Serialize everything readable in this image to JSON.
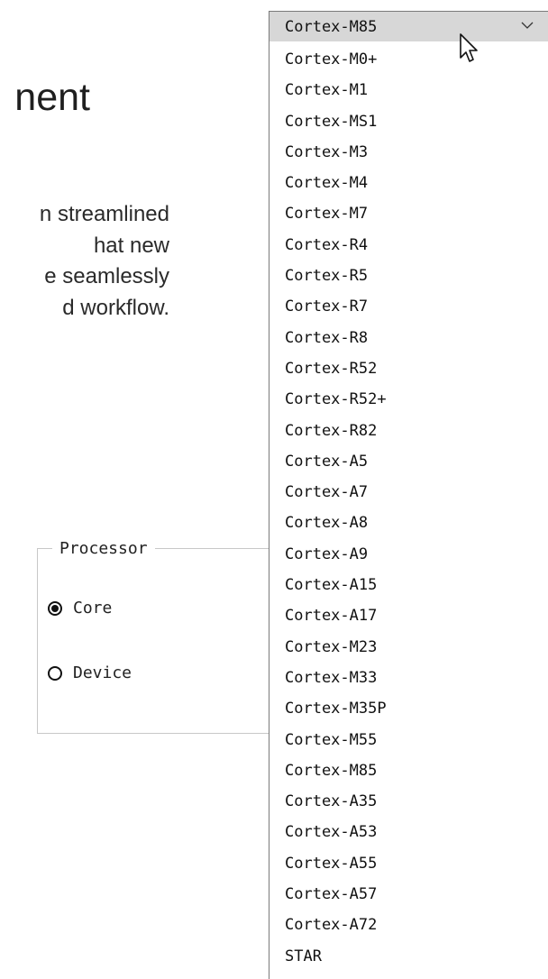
{
  "background": {
    "heading_fragment": "nent",
    "description_lines": [
      "n streamlined",
      "hat new",
      "e seamlessly",
      "d workflow."
    ]
  },
  "processor_group": {
    "legend": "Processor",
    "options": [
      {
        "label": "Core",
        "selected": true
      },
      {
        "label": "Device",
        "selected": false
      }
    ]
  },
  "dropdown": {
    "selected_value": "Cortex-M85",
    "chevron_icon": "chevron-down-icon",
    "items": [
      "Cortex-M0+",
      "Cortex-M1",
      "Cortex-MS1",
      "Cortex-M3",
      "Cortex-M4",
      "Cortex-M7",
      "Cortex-R4",
      "Cortex-R5",
      "Cortex-R7",
      "Cortex-R8",
      "Cortex-R52",
      "Cortex-R52+",
      "Cortex-R82",
      "Cortex-A5",
      "Cortex-A7",
      "Cortex-A8",
      "Cortex-A9",
      "Cortex-A15",
      "Cortex-A17",
      "Cortex-M23",
      "Cortex-M33",
      "Cortex-M35P",
      "Cortex-M55",
      "Cortex-M85",
      "Cortex-A35",
      "Cortex-A53",
      "Cortex-A55",
      "Cortex-A57",
      "Cortex-A72",
      "STAR"
    ]
  },
  "colors": {
    "header_highlight": "#d7d7d7",
    "border": "#7a7a7a",
    "groupbox_border": "#c8c8c8"
  }
}
